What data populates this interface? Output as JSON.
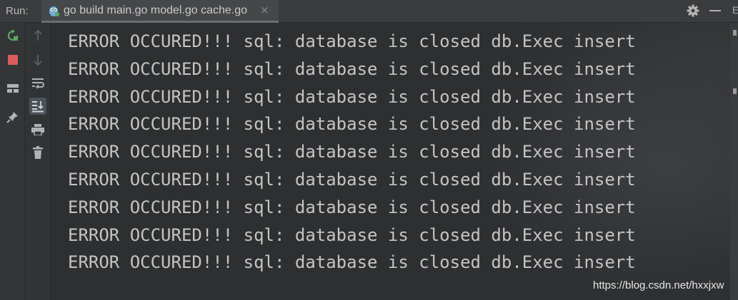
{
  "topbar": {
    "run_label": "Run:",
    "tab_title": "go build main.go model.go cache.go",
    "tab_close": "×",
    "edge_letter": "E"
  },
  "console": {
    "lines": [
      "ERROR OCCURED!!! sql: database is closed db.Exec insert",
      "ERROR OCCURED!!! sql: database is closed db.Exec insert",
      "ERROR OCCURED!!! sql: database is closed db.Exec insert",
      "ERROR OCCURED!!! sql: database is closed db.Exec insert",
      "ERROR OCCURED!!! sql: database is closed db.Exec insert",
      "ERROR OCCURED!!! sql: database is closed db.Exec insert",
      "ERROR OCCURED!!! sql: database is closed db.Exec insert",
      "ERROR OCCURED!!! sql: database is closed db.Exec insert",
      "ERROR OCCURED!!! sql: database is closed db.Exec insert"
    ]
  },
  "watermark": "https://blog.csdn.net/hxxjxw",
  "icons": {
    "gutter1": [
      "rerun-icon",
      "stop-icon",
      "restore-layout-icon",
      "pin-icon"
    ],
    "gutter2": [
      "up-arrow-icon",
      "down-arrow-icon",
      "soft-wrap-icon",
      "scroll-to-end-icon",
      "print-icon",
      "trash-icon"
    ],
    "topbar": [
      "gopher-icon",
      "gear-icon",
      "minimize-icon"
    ]
  },
  "colors": {
    "background": "#2d2f31",
    "console_text": "#c4c4c4",
    "rerun_green": "#59a869",
    "stop_red": "#db5c5c"
  }
}
